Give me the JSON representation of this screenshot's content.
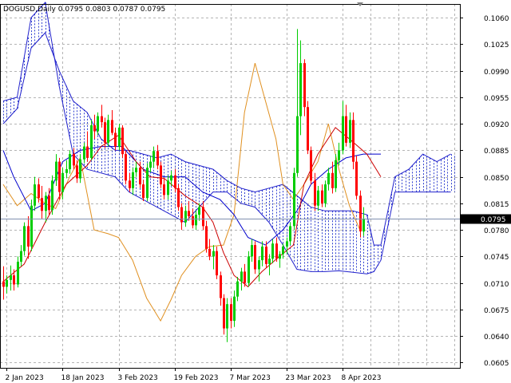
{
  "colors": {
    "background": "#ffffff",
    "grid": "#b4b4b4",
    "frame": "#000000",
    "bull_candle": "#00cc00",
    "bear_candle": "#ff0000",
    "tenkan": "#cc0000",
    "kijun": "#0000cc",
    "chikou": "#e09020",
    "cloud_line": "#2020cc",
    "cloud_hatch": "#3040d0",
    "price_line": "#8090b0",
    "price_label_bg": "#000000",
    "price_label_text": "#ffffff"
  },
  "header": {
    "symbol_label": "DOGUSD,Daily",
    "ohlc": "0.0795 0.0803 0.0787 0.0795"
  },
  "chart_data": {
    "type": "candlestick",
    "title": "DOGUSD,Daily",
    "indicator": "Ichimoku Kinko Hyo",
    "current_price_label": "0.0795",
    "ylim": [
      0.0598,
      0.1078
    ],
    "y_ticks": [
      "0.1060",
      "0.1025",
      "0.0990",
      "0.0955",
      "0.0920",
      "0.0885",
      "0.0850",
      "0.0815",
      "0.0780",
      "0.0745",
      "0.0710",
      "0.0675",
      "0.0640",
      "0.0605"
    ],
    "x_ticks": [
      "2 Jan 2023",
      "18 Jan 2023",
      "3 Feb 2023",
      "19 Feb 2023",
      "7 Mar 2023",
      "23 Mar 2023",
      "8 Apr 2023"
    ],
    "x_tick_bars": [
      1,
      17,
      33,
      49,
      65,
      81,
      97
    ],
    "bar_count": 109,
    "grid": true,
    "candles": [
      [
        0.0712,
        0.0732,
        0.0688,
        0.0705
      ],
      [
        0.0705,
        0.072,
        0.0696,
        0.0714
      ],
      [
        0.0714,
        0.0733,
        0.07,
        0.072
      ],
      [
        0.072,
        0.0728,
        0.07,
        0.0708
      ],
      [
        0.0708,
        0.0745,
        0.0704,
        0.0738
      ],
      [
        0.0738,
        0.076,
        0.0732,
        0.0752
      ],
      [
        0.0752,
        0.079,
        0.0746,
        0.0785
      ],
      [
        0.0785,
        0.0798,
        0.0742,
        0.0758
      ],
      [
        0.0758,
        0.082,
        0.0752,
        0.0812
      ],
      [
        0.0812,
        0.085,
        0.0805,
        0.084
      ],
      [
        0.084,
        0.0848,
        0.0816,
        0.0822
      ],
      [
        0.0822,
        0.0838,
        0.0795,
        0.0805
      ],
      [
        0.0805,
        0.083,
        0.079,
        0.0825
      ],
      [
        0.0825,
        0.0835,
        0.08,
        0.0806
      ],
      [
        0.0806,
        0.0852,
        0.08,
        0.0845
      ],
      [
        0.0845,
        0.088,
        0.0838,
        0.087
      ],
      [
        0.087,
        0.0875,
        0.082,
        0.083
      ],
      [
        0.083,
        0.0862,
        0.082,
        0.0855
      ],
      [
        0.0855,
        0.0872,
        0.0848,
        0.086
      ],
      [
        0.086,
        0.0885,
        0.0854,
        0.088
      ],
      [
        0.088,
        0.0888,
        0.086,
        0.0865
      ],
      [
        0.0865,
        0.0872,
        0.0842,
        0.0848
      ],
      [
        0.0848,
        0.088,
        0.0842,
        0.0873
      ],
      [
        0.0873,
        0.0895,
        0.0868,
        0.089
      ],
      [
        0.089,
        0.091,
        0.087,
        0.0875
      ],
      [
        0.0875,
        0.0925,
        0.0872,
        0.0918
      ],
      [
        0.0918,
        0.0932,
        0.09,
        0.091
      ],
      [
        0.091,
        0.0935,
        0.0905,
        0.093
      ],
      [
        0.093,
        0.0945,
        0.0915,
        0.0922
      ],
      [
        0.0922,
        0.0928,
        0.0888,
        0.0895
      ],
      [
        0.0895,
        0.0932,
        0.089,
        0.0925
      ],
      [
        0.0925,
        0.0938,
        0.0905,
        0.0908
      ],
      [
        0.0908,
        0.0915,
        0.0885,
        0.089
      ],
      [
        0.089,
        0.092,
        0.0885,
        0.0915
      ],
      [
        0.0915,
        0.0918,
        0.0875,
        0.088
      ],
      [
        0.088,
        0.0885,
        0.084,
        0.0845
      ],
      [
        0.0845,
        0.0855,
        0.083,
        0.0835
      ],
      [
        0.0835,
        0.0862,
        0.0826,
        0.0856
      ],
      [
        0.0856,
        0.087,
        0.085,
        0.0862
      ],
      [
        0.0862,
        0.087,
        0.0835,
        0.084
      ],
      [
        0.084,
        0.0846,
        0.0818,
        0.0822
      ],
      [
        0.0822,
        0.0868,
        0.0818,
        0.0862
      ],
      [
        0.0862,
        0.0878,
        0.0856,
        0.087
      ],
      [
        0.087,
        0.089,
        0.0862,
        0.0884
      ],
      [
        0.0884,
        0.0892,
        0.086,
        0.0865
      ],
      [
        0.0865,
        0.087,
        0.0835,
        0.084
      ],
      [
        0.084,
        0.0848,
        0.082,
        0.0826
      ],
      [
        0.0826,
        0.0852,
        0.082,
        0.0845
      ],
      [
        0.0845,
        0.0858,
        0.0838,
        0.0852
      ],
      [
        0.0852,
        0.086,
        0.083,
        0.0835
      ],
      [
        0.0835,
        0.084,
        0.0805,
        0.081
      ],
      [
        0.081,
        0.0815,
        0.078,
        0.079
      ],
      [
        0.079,
        0.0812,
        0.0784,
        0.0805
      ],
      [
        0.0805,
        0.0818,
        0.0792,
        0.0798
      ],
      [
        0.0798,
        0.0808,
        0.0782,
        0.0786
      ],
      [
        0.0786,
        0.0805,
        0.078,
        0.08
      ],
      [
        0.08,
        0.0815,
        0.0792,
        0.081
      ],
      [
        0.081,
        0.0818,
        0.078,
        0.0785
      ],
      [
        0.0785,
        0.0792,
        0.075,
        0.0755
      ],
      [
        0.0755,
        0.0768,
        0.074,
        0.0745
      ],
      [
        0.0745,
        0.076,
        0.0728,
        0.0752
      ],
      [
        0.0752,
        0.0758,
        0.0715,
        0.072
      ],
      [
        0.072,
        0.0725,
        0.068,
        0.069
      ],
      [
        0.069,
        0.0695,
        0.0642,
        0.065
      ],
      [
        0.065,
        0.069,
        0.0632,
        0.0682
      ],
      [
        0.0682,
        0.069,
        0.065,
        0.066
      ],
      [
        0.066,
        0.07,
        0.0652,
        0.0692
      ],
      [
        0.0692,
        0.0718,
        0.0686,
        0.0712
      ],
      [
        0.0712,
        0.073,
        0.07,
        0.0725
      ],
      [
        0.0725,
        0.0735,
        0.0705,
        0.071
      ],
      [
        0.071,
        0.0752,
        0.0705,
        0.0745
      ],
      [
        0.0745,
        0.0768,
        0.0738,
        0.076
      ],
      [
        0.076,
        0.0765,
        0.0722,
        0.0728
      ],
      [
        0.0728,
        0.0745,
        0.0712,
        0.074
      ],
      [
        0.074,
        0.0765,
        0.0732,
        0.0758
      ],
      [
        0.0758,
        0.0765,
        0.073,
        0.0735
      ],
      [
        0.0735,
        0.0748,
        0.072,
        0.0742
      ],
      [
        0.0742,
        0.0768,
        0.0736,
        0.0762
      ],
      [
        0.0762,
        0.077,
        0.0738,
        0.0742
      ],
      [
        0.0742,
        0.0752,
        0.073,
        0.0748
      ],
      [
        0.0748,
        0.0762,
        0.0742,
        0.0758
      ],
      [
        0.0758,
        0.077,
        0.0748,
        0.0765
      ],
      [
        0.0765,
        0.079,
        0.076,
        0.0785
      ],
      [
        0.0785,
        0.0862,
        0.078,
        0.0855
      ],
      [
        0.0855,
        0.1045,
        0.085,
        0.093
      ],
      [
        0.093,
        0.103,
        0.0905,
        0.1
      ],
      [
        0.1,
        0.1005,
        0.093,
        0.0942
      ],
      [
        0.0942,
        0.095,
        0.088,
        0.0885
      ],
      [
        0.0885,
        0.089,
        0.084,
        0.0845
      ],
      [
        0.0845,
        0.0855,
        0.0805,
        0.0812
      ],
      [
        0.0812,
        0.0838,
        0.0805,
        0.0832
      ],
      [
        0.0832,
        0.084,
        0.081,
        0.0815
      ],
      [
        0.0815,
        0.0845,
        0.081,
        0.084
      ],
      [
        0.084,
        0.0862,
        0.0832,
        0.0855
      ],
      [
        0.0855,
        0.087,
        0.0828,
        0.0835
      ],
      [
        0.0835,
        0.088,
        0.083,
        0.0872
      ],
      [
        0.0872,
        0.0895,
        0.0865,
        0.0885
      ],
      [
        0.0885,
        0.095,
        0.088,
        0.093
      ],
      [
        0.093,
        0.0945,
        0.089,
        0.0895
      ],
      [
        0.0895,
        0.0935,
        0.0888,
        0.0925
      ],
      [
        0.0925,
        0.0935,
        0.086,
        0.087
      ],
      [
        0.087,
        0.0878,
        0.082,
        0.0825
      ],
      [
        0.0825,
        0.0832,
        0.077,
        0.0778
      ],
      [
        0.0778,
        0.081,
        0.0772,
        0.0795
      ]
    ],
    "tenkan": [
      [
        0,
        0.0712
      ],
      [
        6,
        0.0735
      ],
      [
        12,
        0.079
      ],
      [
        18,
        0.084
      ],
      [
        24,
        0.0865
      ],
      [
        28,
        0.089
      ],
      [
        33,
        0.0905
      ],
      [
        38,
        0.087
      ],
      [
        42,
        0.085
      ],
      [
        46,
        0.0848
      ],
      [
        52,
        0.0825
      ],
      [
        57,
        0.081
      ],
      [
        60,
        0.079
      ],
      [
        63,
        0.075
      ],
      [
        66,
        0.072
      ],
      [
        70,
        0.0705
      ],
      [
        74,
        0.0725
      ],
      [
        79,
        0.0745
      ],
      [
        83,
        0.076
      ],
      [
        86,
        0.084
      ],
      [
        90,
        0.088
      ],
      [
        95,
        0.0915
      ],
      [
        99,
        0.09
      ],
      [
        104,
        0.088
      ],
      [
        108,
        0.085
      ]
    ],
    "kijun": [
      [
        0,
        0.0885
      ],
      [
        3,
        0.085
      ],
      [
        8,
        0.0805
      ],
      [
        12,
        0.0815
      ],
      [
        17,
        0.087
      ],
      [
        22,
        0.0885
      ],
      [
        28,
        0.089
      ],
      [
        34,
        0.089
      ],
      [
        40,
        0.086
      ],
      [
        46,
        0.085
      ],
      [
        52,
        0.085
      ],
      [
        57,
        0.083
      ],
      [
        62,
        0.082
      ],
      [
        66,
        0.08
      ],
      [
        70,
        0.077
      ],
      [
        75,
        0.076
      ],
      [
        80,
        0.078
      ],
      [
        84,
        0.0805
      ],
      [
        88,
        0.084
      ],
      [
        93,
        0.086
      ],
      [
        98,
        0.0875
      ],
      [
        103,
        0.088
      ],
      [
        108,
        0.088
      ]
    ],
    "chikou": [
      [
        0,
        0.084
      ],
      [
        4,
        0.0812
      ],
      [
        8,
        0.0828
      ],
      [
        12,
        0.0815
      ],
      [
        15,
        0.0808
      ],
      [
        19,
        0.085
      ],
      [
        22,
        0.0875
      ],
      [
        26,
        0.078
      ],
      [
        30,
        0.0775
      ],
      [
        33,
        0.077
      ],
      [
        37,
        0.074
      ],
      [
        41,
        0.069
      ],
      [
        45,
        0.066
      ],
      [
        48,
        0.0688
      ],
      [
        51,
        0.072
      ],
      [
        55,
        0.0745
      ],
      [
        59,
        0.0758
      ],
      [
        63,
        0.076
      ],
      [
        66,
        0.08
      ],
      [
        69,
        0.0935
      ],
      [
        72,
        0.1
      ],
      [
        75,
        0.095
      ],
      [
        78,
        0.09
      ],
      [
        80,
        0.084
      ],
      [
        83,
        0.082
      ],
      [
        86,
        0.084
      ],
      [
        90,
        0.087
      ],
      [
        93,
        0.092
      ],
      [
        96,
        0.086
      ],
      [
        99,
        0.0812
      ],
      [
        102,
        0.078
      ]
    ],
    "span_a": [
      [
        0,
        0.092
      ],
      [
        4,
        0.094
      ],
      [
        8,
        0.102
      ],
      [
        12,
        0.104
      ],
      [
        16,
        0.099
      ],
      [
        20,
        0.095
      ],
      [
        24,
        0.0935
      ],
      [
        28,
        0.09
      ],
      [
        32,
        0.0885
      ],
      [
        36,
        0.0885
      ],
      [
        40,
        0.088
      ],
      [
        44,
        0.0875
      ],
      [
        48,
        0.088
      ],
      [
        52,
        0.087
      ],
      [
        56,
        0.0865
      ],
      [
        60,
        0.086
      ],
      [
        64,
        0.0845
      ],
      [
        68,
        0.0835
      ],
      [
        72,
        0.083
      ],
      [
        76,
        0.0835
      ],
      [
        80,
        0.084
      ],
      [
        84,
        0.0825
      ],
      [
        88,
        0.081
      ],
      [
        92,
        0.0805
      ],
      [
        96,
        0.0805
      ],
      [
        100,
        0.0805
      ],
      [
        104,
        0.08
      ],
      [
        106,
        0.076
      ],
      [
        108,
        0.076
      ],
      [
        112,
        0.085
      ],
      [
        116,
        0.086
      ],
      [
        120,
        0.088
      ],
      [
        124,
        0.087
      ],
      [
        128,
        0.088
      ],
      [
        132,
        0.087
      ],
      [
        136,
        0.0865
      ]
    ],
    "span_b": [
      [
        0,
        0.095
      ],
      [
        4,
        0.0955
      ],
      [
        8,
        0.106
      ],
      [
        12,
        0.108
      ],
      [
        16,
        0.097
      ],
      [
        20,
        0.088
      ],
      [
        24,
        0.086
      ],
      [
        28,
        0.0855
      ],
      [
        32,
        0.085
      ],
      [
        36,
        0.083
      ],
      [
        40,
        0.082
      ],
      [
        44,
        0.081
      ],
      [
        48,
        0.08
      ],
      [
        52,
        0.079
      ],
      [
        56,
        0.081
      ],
      [
        60,
        0.083
      ],
      [
        64,
        0.083
      ],
      [
        68,
        0.0815
      ],
      [
        72,
        0.081
      ],
      [
        76,
        0.079
      ],
      [
        80,
        0.076
      ],
      [
        84,
        0.0728
      ],
      [
        88,
        0.0725
      ],
      [
        92,
        0.0725
      ],
      [
        96,
        0.0726
      ],
      [
        100,
        0.0724
      ],
      [
        104,
        0.0722
      ],
      [
        106,
        0.0725
      ],
      [
        108,
        0.074
      ],
      [
        112,
        0.083
      ],
      [
        116,
        0.083
      ],
      [
        120,
        0.083
      ],
      [
        124,
        0.083
      ],
      [
        128,
        0.083
      ],
      [
        132,
        0.083
      ],
      [
        136,
        0.083
      ]
    ]
  }
}
